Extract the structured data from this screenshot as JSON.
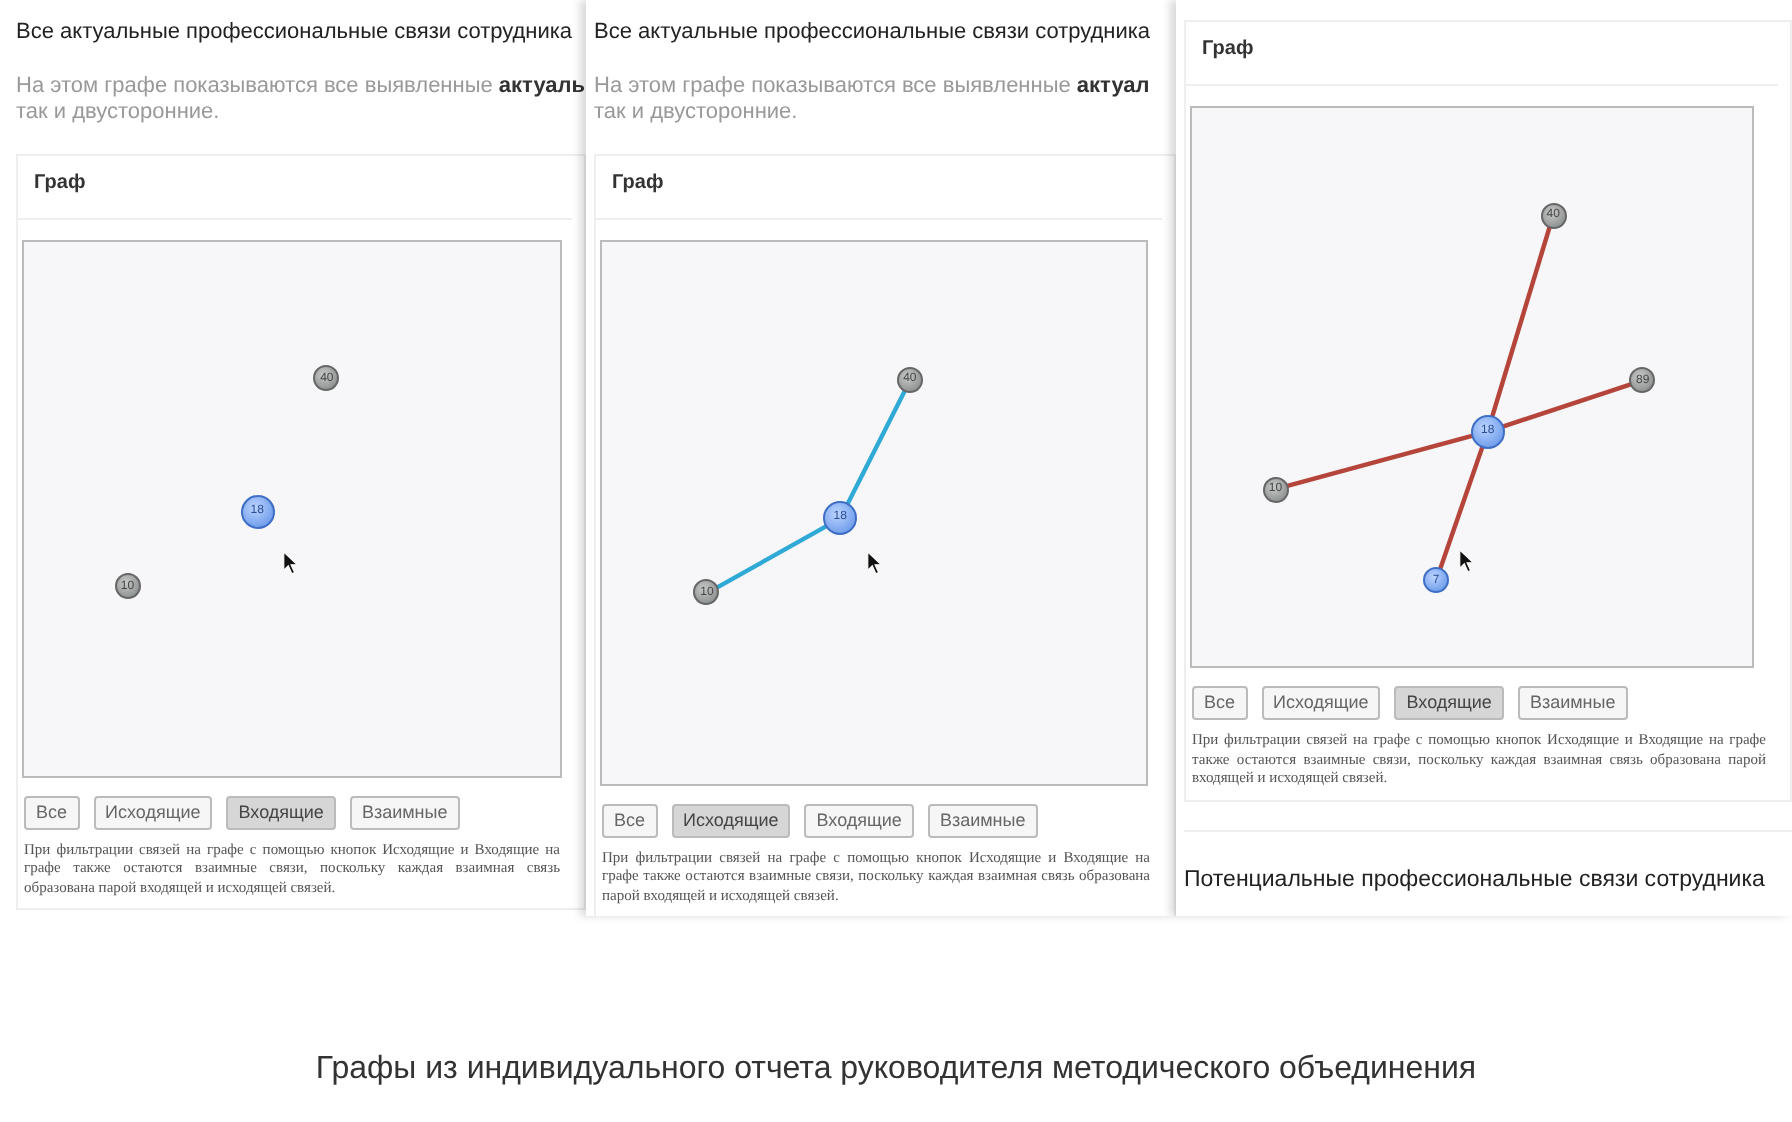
{
  "panels": [
    {
      "title": "Все актуальные профессиональные связи сотрудника",
      "description": "На этом графе показываются все выявленные **актуаль**",
      "description_line2": "так и двусторонние.",
      "card_title": "Граф",
      "nodes": [
        {
          "label": "18",
          "kind": "center"
        },
        {
          "label": "40",
          "kind": "other"
        },
        {
          "label": "10",
          "kind": "other"
        }
      ],
      "buttons": [
        {
          "label": "Все",
          "selected": false
        },
        {
          "label": "Исходящие",
          "selected": false
        },
        {
          "label": "Входящие",
          "selected": true
        },
        {
          "label": "Взаимные",
          "selected": false
        }
      ],
      "note": "При фильтрации связей на графе с помощью кнопок Исходящие и Входящие на графе также остаются взаимные связи, поскольку каждая взаимная связь образована парой входящей и исходящей связей."
    },
    {
      "title": "Все актуальные профессиональные связи сотрудника",
      "description": "На этом графе показываются все выявленные **актуал**",
      "description_line2": "так и двусторонние.",
      "card_title": "Граф",
      "nodes": [
        {
          "label": "18",
          "kind": "center"
        },
        {
          "label": "40",
          "kind": "other"
        },
        {
          "label": "10",
          "kind": "other"
        }
      ],
      "edges": [
        {
          "color": "#2fa9d6"
        },
        {
          "color": "#2fa9d6"
        }
      ],
      "buttons": [
        {
          "label": "Все",
          "selected": false
        },
        {
          "label": "Исходящие",
          "selected": true
        },
        {
          "label": "Входящие",
          "selected": false
        },
        {
          "label": "Взаимные",
          "selected": false
        }
      ],
      "note": "При фильтрации связей на графе с помощью кнопок Исходящие и Входящие на графе также остаются взаимные связи, поскольку каждая взаимная связь образована парой входящей и исходящей связей."
    },
    {
      "card_title": "Граф",
      "nodes": [
        {
          "label": "18",
          "kind": "center"
        },
        {
          "label": "40",
          "kind": "other"
        },
        {
          "label": "89",
          "kind": "other"
        },
        {
          "label": "10",
          "kind": "other"
        },
        {
          "label": "7",
          "kind": "small_center"
        }
      ],
      "edges": [
        {
          "color": "#b5453a"
        },
        {
          "color": "#b5453a"
        },
        {
          "color": "#b5453a"
        },
        {
          "color": "#b5453a"
        }
      ],
      "buttons": [
        {
          "label": "Все",
          "selected": false
        },
        {
          "label": "Исходящие",
          "selected": false
        },
        {
          "label": "Входящие",
          "selected": true
        },
        {
          "label": "Взаимные",
          "selected": false
        }
      ],
      "note": "При фильтрации связей на графе с помощью кнопок Исходящие и Входящие на графе также остаются взаимные связи, поскольку каждая взаимная связь образована парой входящей и исходящей связей.",
      "footer_heading": "Потенциальные профессиональные связи сотрудника"
    }
  ],
  "caption": "Графы из индивидуального отчета руководителя методического объединения"
}
